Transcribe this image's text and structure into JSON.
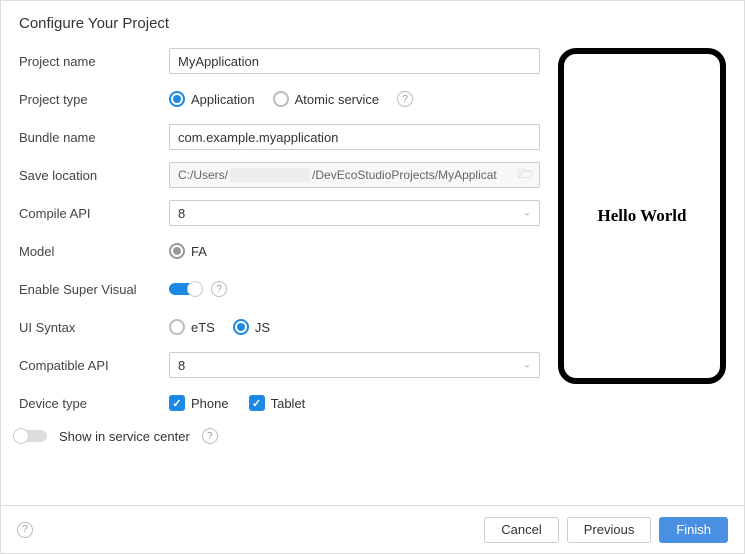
{
  "title": "Configure Your Project",
  "labels": {
    "project_name": "Project name",
    "project_type": "Project type",
    "bundle_name": "Bundle name",
    "save_location": "Save location",
    "compile_api": "Compile API",
    "model": "Model",
    "enable_super_visual": "Enable Super Visual",
    "ui_syntax": "UI Syntax",
    "compatible_api": "Compatible API",
    "device_type": "Device type",
    "show_in_service_center": "Show in service center"
  },
  "values": {
    "project_name": "MyApplication",
    "bundle_name": "com.example.myapplication",
    "save_location_prefix": "C:/Users/",
    "save_location_suffix": "/DevEcoStudioProjects/MyApplicat",
    "compile_api": "8",
    "compatible_api": "8"
  },
  "project_type": {
    "application": "Application",
    "atomic_service": "Atomic service"
  },
  "model": {
    "fa": "FA"
  },
  "ui_syntax": {
    "ets": "eTS",
    "js": "JS"
  },
  "device_type": {
    "phone": "Phone",
    "tablet": "Tablet"
  },
  "preview": {
    "text": "Hello World"
  },
  "buttons": {
    "cancel": "Cancel",
    "previous": "Previous",
    "finish": "Finish"
  },
  "help_char": "?"
}
